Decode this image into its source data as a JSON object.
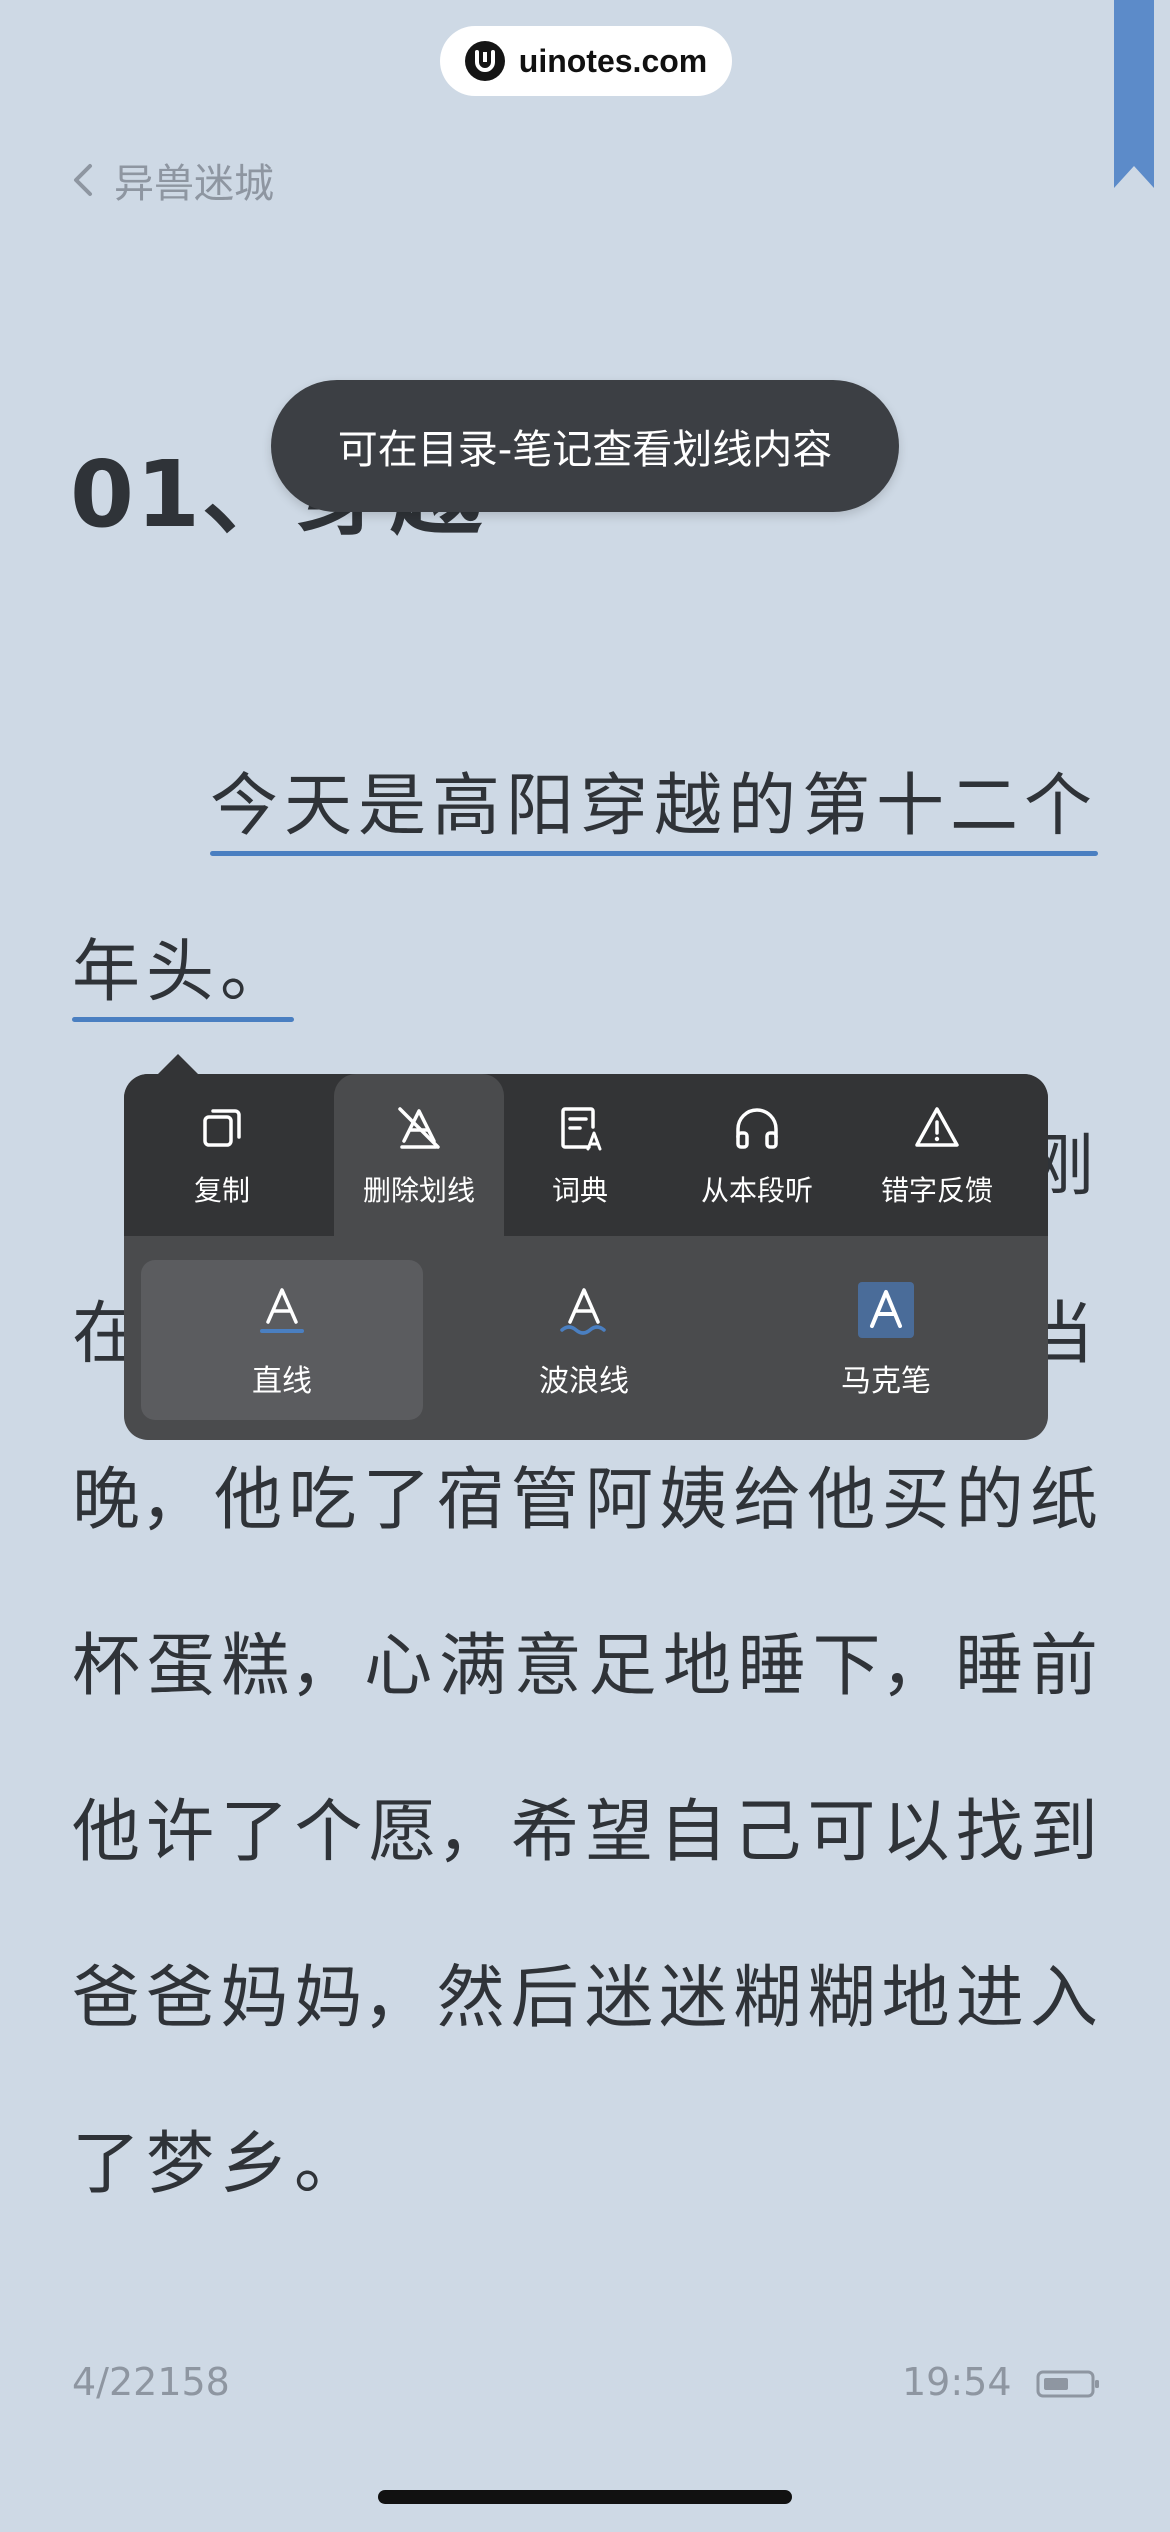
{
  "watermark": {
    "text": "uinotes.com"
  },
  "nav": {
    "back_label": "异兽迷城"
  },
  "chapter": {
    "title": "01、穿越"
  },
  "toast": {
    "text": "可在目录-笔记查看划线内容"
  },
  "body_text": {
    "line1": "今天是高阳穿越的第十二个",
    "line2": "年头。",
    "line3_visible_end": "刚",
    "line4_start": "在",
    "line4_end": "当",
    "line5": [
      "晚，",
      "他",
      "吃",
      "了",
      "宿",
      "管",
      "阿",
      "姨",
      "给",
      "他",
      "买",
      "的",
      "纸"
    ],
    "line6": [
      "杯",
      "蛋",
      "糕，",
      "心",
      "满",
      "意",
      "足",
      "地",
      "睡",
      "下，",
      "睡",
      "前"
    ],
    "line7": [
      "他",
      "许",
      "了",
      "个",
      "愿，",
      "希",
      "望",
      "自",
      "己",
      "可",
      "以",
      "找",
      "到"
    ],
    "line8": [
      "爸",
      "爸",
      "妈",
      "妈，",
      "然",
      "后",
      "迷",
      "迷",
      "糊",
      "糊",
      "地",
      "进",
      "入"
    ],
    "line9": "了梦乡。"
  },
  "menu": {
    "actions": [
      {
        "label": "复制",
        "icon": "copy-icon"
      },
      {
        "label": "删除划线",
        "icon": "delete-underline-icon"
      },
      {
        "label": "词典",
        "icon": "dictionary-icon"
      },
      {
        "label": "从本段听",
        "icon": "headphones-icon"
      },
      {
        "label": "错字反馈",
        "icon": "warning-icon"
      }
    ],
    "styles": [
      {
        "label": "直线",
        "icon": "straight-underline-icon"
      },
      {
        "label": "波浪线",
        "icon": "wavy-underline-icon"
      },
      {
        "label": "马克笔",
        "icon": "marker-icon"
      }
    ],
    "active_action": "删除划线",
    "selected_style": "直线"
  },
  "footer": {
    "page": "4/22158",
    "time": "19:54"
  },
  "colors": {
    "background": "#ced9e5",
    "accent": "#4a7fc1",
    "menu_dark": "#333436",
    "menu_light": "#4a4b4d",
    "bookmark": "#5c8bc9"
  }
}
